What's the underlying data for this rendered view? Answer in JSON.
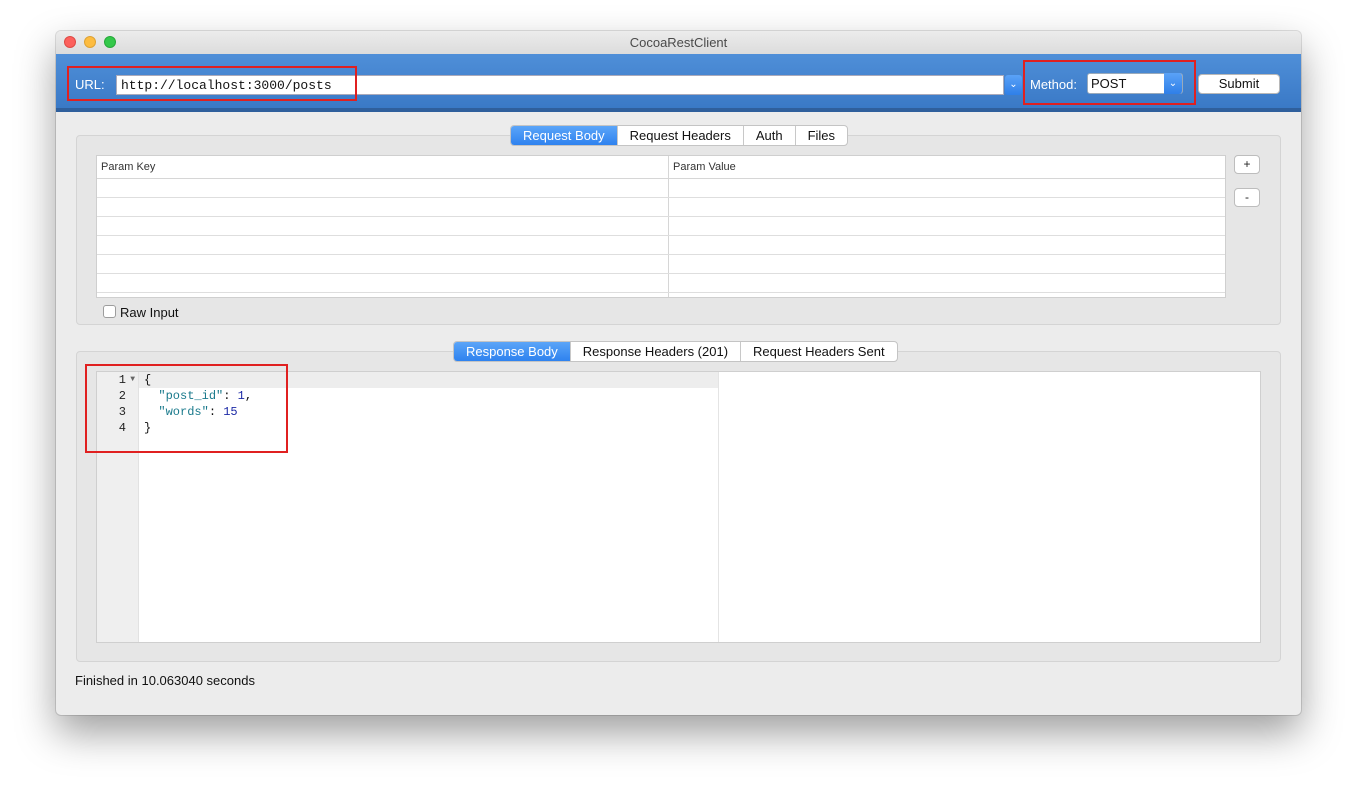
{
  "window": {
    "title": "CocoaRestClient"
  },
  "toolbar": {
    "url_label": "URL:",
    "url_value": "http://localhost:3000/posts",
    "method_label": "Method:",
    "method_value": "POST",
    "submit_label": "Submit"
  },
  "request": {
    "tabs": [
      {
        "label": "Request Body",
        "active": true
      },
      {
        "label": "Request Headers",
        "active": false
      },
      {
        "label": "Auth",
        "active": false
      },
      {
        "label": "Files",
        "active": false
      }
    ],
    "table": {
      "columns": [
        "Param Key",
        "Param Value"
      ],
      "rows": []
    },
    "add_label": "+",
    "remove_label": "-",
    "raw_input_label": "Raw Input",
    "raw_input_checked": false
  },
  "response": {
    "tabs": [
      {
        "label": "Response Body",
        "active": true
      },
      {
        "label": "Response Headers (201)",
        "active": false
      },
      {
        "label": "Request Headers Sent",
        "active": false
      }
    ],
    "line_numbers": [
      "1",
      "2",
      "3",
      "4"
    ],
    "code": {
      "open": "{",
      "key1": "\"post_id\"",
      "val1": "1",
      "key2": "\"words\"",
      "val2": "15",
      "close": "}"
    }
  },
  "status": {
    "text": "Finished in 10.063040 seconds"
  },
  "colors": {
    "toolbar_blue": "#3a79c6",
    "active_tab": "#2e82ef",
    "highlight_red": "#e02020"
  }
}
